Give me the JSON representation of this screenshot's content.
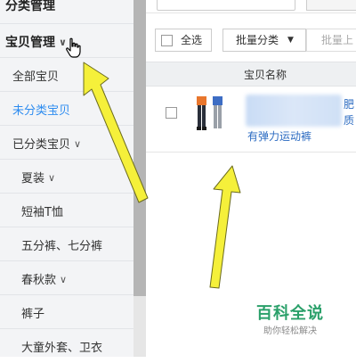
{
  "sidebar": {
    "section_top": "分类管理",
    "section_items": "宝贝管理",
    "items": [
      {
        "label": "全部宝贝",
        "active": false
      },
      {
        "label": "未分类宝贝",
        "active": true
      },
      {
        "label": "已分类宝贝",
        "expanded": true
      },
      {
        "label": "夏装",
        "expanded": true
      },
      {
        "label": "短袖T恤"
      },
      {
        "label": "五分裤、七分裤"
      },
      {
        "label": "春秋款",
        "expanded": true
      },
      {
        "label": "裤子"
      },
      {
        "label": "大童外套、卫衣"
      }
    ]
  },
  "toolbar": {
    "select_all_label": "全选",
    "bulk_category_label": "批量分类",
    "bulk_up_label": "批量上"
  },
  "table": {
    "header_name": "宝贝名称",
    "rows": [
      {
        "title_visible": "有弹力运动裤",
        "side_text_1": "肥",
        "side_text_2": "质"
      }
    ]
  },
  "watermark": {
    "title": "百科全说",
    "subtitle": "助你轻松解决"
  },
  "colors": {
    "accent": "#2d8cf0",
    "arrow": "#f5f03a",
    "watermark": "#2aa06a"
  }
}
